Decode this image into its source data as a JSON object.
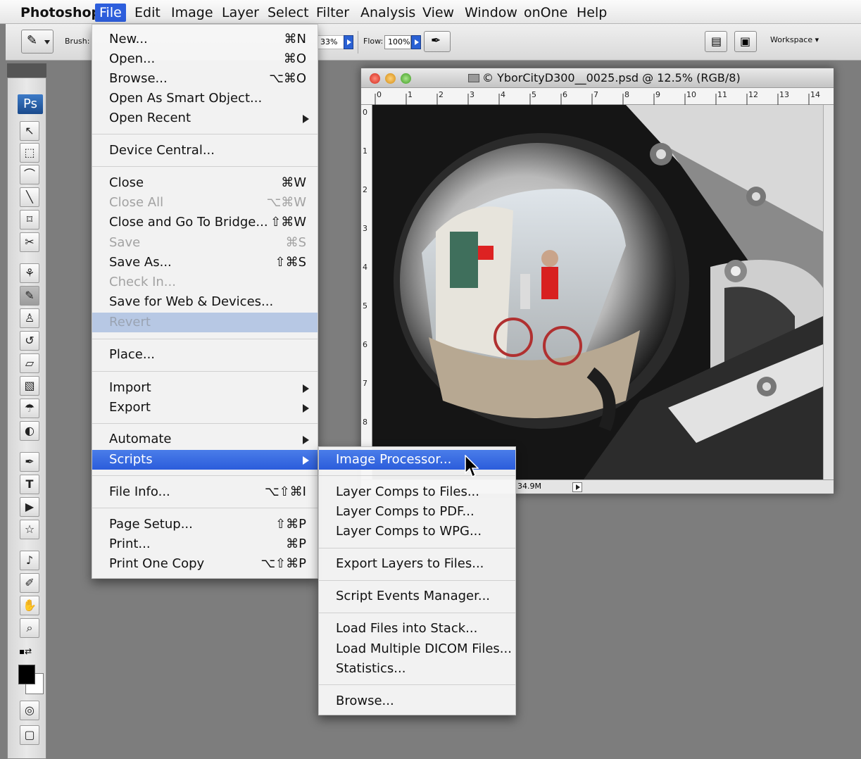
{
  "menubar": {
    "items": [
      "Photoshop",
      "File",
      "Edit",
      "Image",
      "Layer",
      "Select",
      "Filter",
      "Analysis",
      "View",
      "Window",
      "onOne",
      "Help"
    ],
    "active": "File"
  },
  "options_bar": {
    "brush_label": "Brush:",
    "opacity_value": "33%",
    "flow_label": "Flow:",
    "flow_value": "100%",
    "workspace_label": "Workspace ▾"
  },
  "tools": {
    "logo": "Ps"
  },
  "document": {
    "title": "© YborCityD300__0025.psd @ 12.5% (RGB/8)",
    "status_size": "34.9M",
    "h_ruler": [
      "0",
      "1",
      "2",
      "3",
      "4",
      "5",
      "6",
      "7",
      "8",
      "9",
      "10",
      "11",
      "12",
      "13",
      "14"
    ],
    "v_ruler": [
      "0",
      "1",
      "2",
      "3",
      "4",
      "5",
      "6",
      "7",
      "8"
    ]
  },
  "file_menu": {
    "items": [
      {
        "label": "New...",
        "shortcut": "⌘N"
      },
      {
        "label": "Open...",
        "shortcut": "⌘O"
      },
      {
        "label": "Browse...",
        "shortcut": "⌥⌘O"
      },
      {
        "label": "Open As Smart Object...",
        "shortcut": ""
      },
      {
        "label": "Open Recent",
        "shortcut": ""
      },
      {
        "label": "Device Central...",
        "shortcut": ""
      },
      {
        "label": "Close",
        "shortcut": "⌘W"
      },
      {
        "label": "Close All",
        "shortcut": "⌥⌘W"
      },
      {
        "label": "Close and Go To Bridge...",
        "shortcut": "⇧⌘W"
      },
      {
        "label": "Save",
        "shortcut": "⌘S"
      },
      {
        "label": "Save As...",
        "shortcut": "⇧⌘S"
      },
      {
        "label": "Check In...",
        "shortcut": ""
      },
      {
        "label": "Save for Web & Devices...",
        "shortcut": ""
      },
      {
        "label": "Revert",
        "shortcut": ""
      },
      {
        "label": "Place...",
        "shortcut": ""
      },
      {
        "label": "Import",
        "shortcut": ""
      },
      {
        "label": "Export",
        "shortcut": ""
      },
      {
        "label": "Automate",
        "shortcut": ""
      },
      {
        "label": "Scripts",
        "shortcut": ""
      },
      {
        "label": "File Info...",
        "shortcut": "⌥⇧⌘I"
      },
      {
        "label": "Page Setup...",
        "shortcut": "⇧⌘P"
      },
      {
        "label": "Print...",
        "shortcut": "⌘P"
      },
      {
        "label": "Print One Copy",
        "shortcut": "⌥⇧⌘P"
      }
    ]
  },
  "scripts_menu": {
    "items": [
      "Image Processor...",
      "Layer Comps to Files...",
      "Layer Comps to PDF...",
      "Layer Comps to WPG...",
      "Export Layers to Files...",
      "Script Events Manager...",
      "Load Files into Stack...",
      "Load Multiple DICOM Files...",
      "Statistics...",
      "Browse..."
    ]
  },
  "colors": {
    "highlight": "#2b5cdb",
    "workspace_bg": "#7d7d7d"
  }
}
